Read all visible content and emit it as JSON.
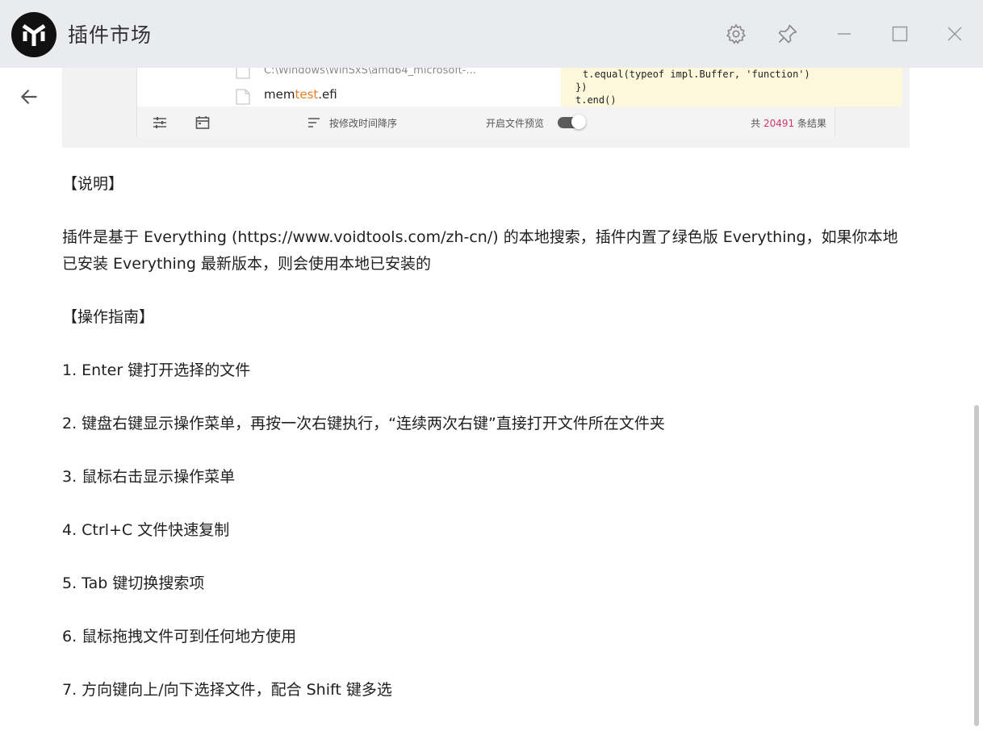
{
  "app": {
    "title": "插件市场"
  },
  "preview": {
    "file_path": "C:\\Windows\\WinSxS\\amd64_microsoft-...",
    "file_name_prefix": "mem",
    "file_name_highlight": "test",
    "file_name_suffix": ".efi",
    "code_lines": [
      "t.equal(typeof impl.Buffer, 'function')",
      "})",
      "t.end()"
    ],
    "sort_label": "按修改时间降序",
    "preview_toggle_label": "开启文件预览",
    "count_prefix": "共",
    "count_value": "20491",
    "count_suffix": "条结果"
  },
  "content": {
    "section1_title": "【说明】",
    "section1_body": "插件是基于 Everything (https://www.voidtools.com/zh-cn/) 的本地搜索，插件内置了绿色版 Everything，如果你本地已安装 Everything 最新版本，则会使用本地已安装的",
    "section2_title": "【操作指南】",
    "items": [
      "1. Enter 键打开选择的文件",
      "2. 键盘右键显示操作菜单，再按一次右键执行，“连续两次右键”直接打开文件所在文件夹",
      "3. 鼠标右击显示操作菜单",
      "4. Ctrl+C 文件快速复制",
      "5. Tab 键切换搜索项",
      "6. 鼠标拖拽文件可到任何地方使用",
      "7. 方向键向上/向下选择文件，配合 Shift 键多选"
    ]
  },
  "colors": {
    "titlebar_bg": "#e9ebee",
    "highlight": "#e67e22",
    "count_accent": "#d6336c"
  }
}
